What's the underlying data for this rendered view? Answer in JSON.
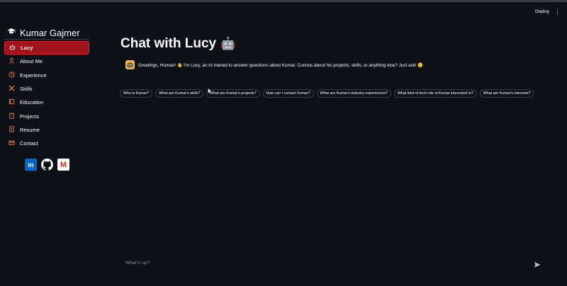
{
  "header": {
    "deploy_label": "Deploy",
    "menu_icon": "kebab-icon"
  },
  "sidebar": {
    "title": "Kumar Gajmer",
    "title_icon": "graduation-cap-icon",
    "accent": "#a1131c",
    "items": [
      {
        "label": "Lucy",
        "icon": "robot-icon"
      },
      {
        "label": "About Me",
        "icon": "person-icon"
      },
      {
        "label": "Experience",
        "icon": "clock-icon"
      },
      {
        "label": "Skills",
        "icon": "tools-icon"
      },
      {
        "label": "Education",
        "icon": "book-icon"
      },
      {
        "label": "Projects",
        "icon": "clipboard-icon"
      },
      {
        "label": "Resume",
        "icon": "document-icon"
      },
      {
        "label": "Contact",
        "icon": "mail-icon"
      }
    ],
    "social": [
      {
        "name": "linkedin-icon",
        "label": "in"
      },
      {
        "name": "github-icon"
      },
      {
        "name": "gmail-icon",
        "label": "M"
      }
    ]
  },
  "main": {
    "title": "Chat with Lucy",
    "title_emoji": "🤖",
    "greeting": "Greetings, Human! 👋 I'm Lucy, an AI trained to answer questions about Kumar. Curious about his projects, skills, or anything else? Just ask! 😊",
    "suggestions": [
      "Who is Kumar?",
      "What are Kumar's skills?",
      "What are Kumar's projects?",
      "How can I contact Kumar?",
      "What are Kumar's industry experiences?",
      "What kind of tech role is Kumar interested in?",
      "What are Kumar's interests?"
    ]
  },
  "chat_input": {
    "placeholder": "What is up?",
    "send_icon": "send-icon"
  }
}
